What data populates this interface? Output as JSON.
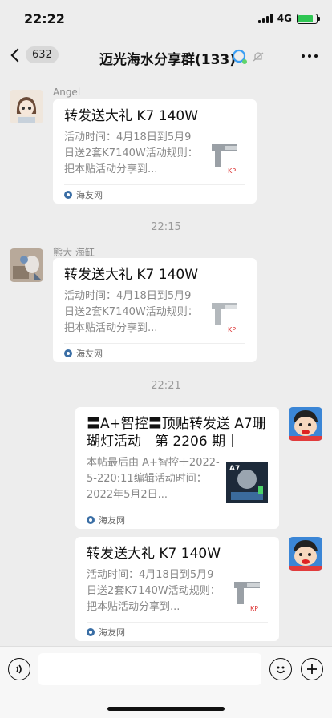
{
  "status": {
    "time": "22:22",
    "network": "4G"
  },
  "nav": {
    "back_count": "632",
    "title": "迈光海水分享群(133)"
  },
  "messages": [
    {
      "sender": "Angel",
      "title": "转发送大礼 K7 140W",
      "desc": "活动时间：4月18日到5月9日送2套K7140W活动规则：把本贴活动分享到...",
      "source": "海友网"
    },
    {
      "time": "22:15"
    },
    {
      "sender": "熊大 海缸",
      "title": "转发送大礼 K7 140W",
      "desc": "活动时间：4月18日到5月9日送2套K7140W活动规则：把本贴活动分享到...",
      "source": "海友网"
    },
    {
      "time": "22:21"
    },
    {
      "title": "〓A+智控〓顶贴转发送 A7珊瑚灯活动｜第 2206 期｜",
      "desc": "本帖最后由 A+智控于2022-5-220:11编辑活动时间：2022年5月2日...",
      "source": "海友网",
      "thumb_label": "A7"
    },
    {
      "title": "转发送大礼 K7 140W",
      "desc": "活动时间：4月18日到5月9日送2套K7140W活动规则：把本贴活动分享到...",
      "source": "海友网"
    }
  ],
  "colors": {
    "background": "#ededed",
    "card": "#ffffff",
    "battery": "#2fc653",
    "meta_text": "#8a8a8a"
  }
}
